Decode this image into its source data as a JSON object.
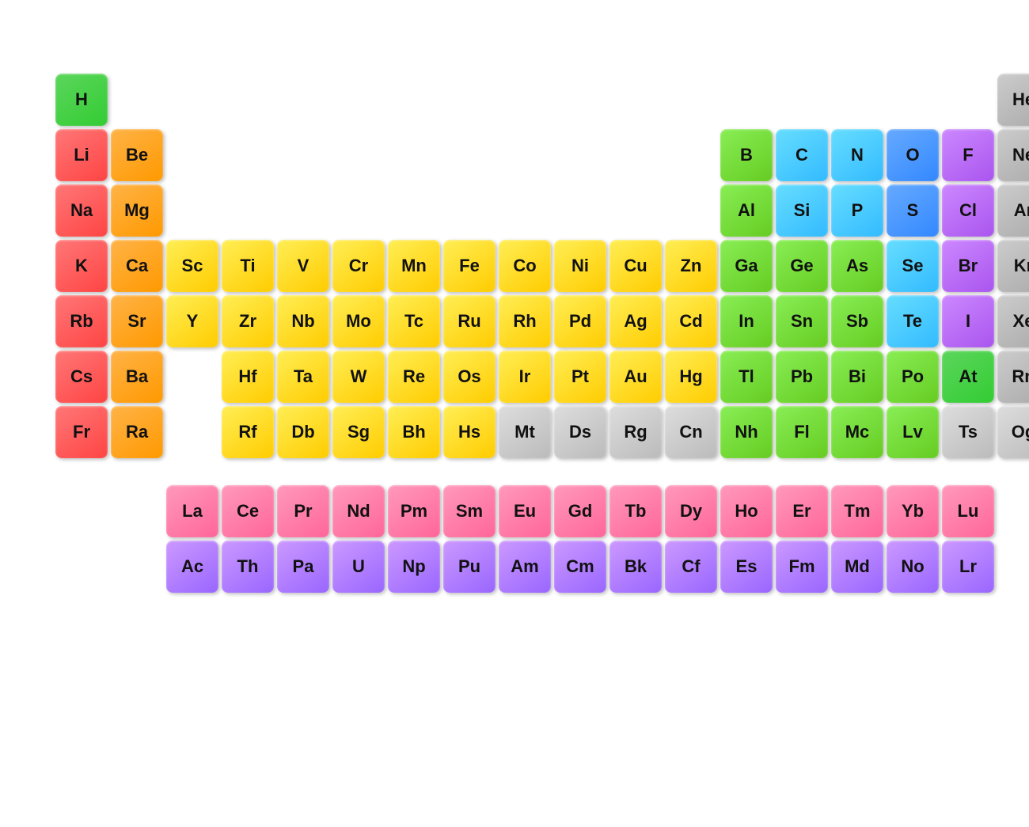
{
  "elements": [
    {
      "symbol": "H",
      "col": 0,
      "row": 0,
      "color": "c-green"
    },
    {
      "symbol": "He",
      "col": 17,
      "row": 0,
      "color": "c-gray"
    },
    {
      "symbol": "Li",
      "col": 0,
      "row": 1,
      "color": "c-red"
    },
    {
      "symbol": "Be",
      "col": 1,
      "row": 1,
      "color": "c-orange"
    },
    {
      "symbol": "B",
      "col": 12,
      "row": 1,
      "color": "c-lgreen"
    },
    {
      "symbol": "C",
      "col": 13,
      "row": 1,
      "color": "c-cyan"
    },
    {
      "symbol": "N",
      "col": 14,
      "row": 1,
      "color": "c-cyan"
    },
    {
      "symbol": "O",
      "col": 15,
      "row": 1,
      "color": "c-blue"
    },
    {
      "symbol": "F",
      "col": 16,
      "row": 1,
      "color": "c-purple"
    },
    {
      "symbol": "Ne",
      "col": 17,
      "row": 1,
      "color": "c-gray"
    },
    {
      "symbol": "Na",
      "col": 0,
      "row": 2,
      "color": "c-red"
    },
    {
      "symbol": "Mg",
      "col": 1,
      "row": 2,
      "color": "c-orange"
    },
    {
      "symbol": "Al",
      "col": 12,
      "row": 2,
      "color": "c-lgreen"
    },
    {
      "symbol": "Si",
      "col": 13,
      "row": 2,
      "color": "c-cyan"
    },
    {
      "symbol": "P",
      "col": 14,
      "row": 2,
      "color": "c-cyan"
    },
    {
      "symbol": "S",
      "col": 15,
      "row": 2,
      "color": "c-blue"
    },
    {
      "symbol": "Cl",
      "col": 16,
      "row": 2,
      "color": "c-purple"
    },
    {
      "symbol": "Ar",
      "col": 17,
      "row": 2,
      "color": "c-gray"
    },
    {
      "symbol": "K",
      "col": 0,
      "row": 3,
      "color": "c-red"
    },
    {
      "symbol": "Ca",
      "col": 1,
      "row": 3,
      "color": "c-orange"
    },
    {
      "symbol": "Sc",
      "col": 2,
      "row": 3,
      "color": "c-yellow"
    },
    {
      "symbol": "Ti",
      "col": 3,
      "row": 3,
      "color": "c-yellow"
    },
    {
      "symbol": "V",
      "col": 4,
      "row": 3,
      "color": "c-yellow"
    },
    {
      "symbol": "Cr",
      "col": 5,
      "row": 3,
      "color": "c-yellow"
    },
    {
      "symbol": "Mn",
      "col": 6,
      "row": 3,
      "color": "c-yellow"
    },
    {
      "symbol": "Fe",
      "col": 7,
      "row": 3,
      "color": "c-yellow"
    },
    {
      "symbol": "Co",
      "col": 8,
      "row": 3,
      "color": "c-yellow"
    },
    {
      "symbol": "Ni",
      "col": 9,
      "row": 3,
      "color": "c-yellow"
    },
    {
      "symbol": "Cu",
      "col": 10,
      "row": 3,
      "color": "c-yellow"
    },
    {
      "symbol": "Zn",
      "col": 11,
      "row": 3,
      "color": "c-yellow"
    },
    {
      "symbol": "Ga",
      "col": 12,
      "row": 3,
      "color": "c-lgreen"
    },
    {
      "symbol": "Ge",
      "col": 13,
      "row": 3,
      "color": "c-lgreen"
    },
    {
      "symbol": "As",
      "col": 14,
      "row": 3,
      "color": "c-lgreen"
    },
    {
      "symbol": "Se",
      "col": 15,
      "row": 3,
      "color": "c-cyan"
    },
    {
      "symbol": "Br",
      "col": 16,
      "row": 3,
      "color": "c-purple"
    },
    {
      "symbol": "Kr",
      "col": 17,
      "row": 3,
      "color": "c-gray"
    },
    {
      "symbol": "Rb",
      "col": 0,
      "row": 4,
      "color": "c-red"
    },
    {
      "symbol": "Sr",
      "col": 1,
      "row": 4,
      "color": "c-orange"
    },
    {
      "symbol": "Y",
      "col": 2,
      "row": 4,
      "color": "c-yellow"
    },
    {
      "symbol": "Zr",
      "col": 3,
      "row": 4,
      "color": "c-yellow"
    },
    {
      "symbol": "Nb",
      "col": 4,
      "row": 4,
      "color": "c-yellow"
    },
    {
      "symbol": "Mo",
      "col": 5,
      "row": 4,
      "color": "c-yellow"
    },
    {
      "symbol": "Tc",
      "col": 6,
      "row": 4,
      "color": "c-yellow"
    },
    {
      "symbol": "Ru",
      "col": 7,
      "row": 4,
      "color": "c-yellow"
    },
    {
      "symbol": "Rh",
      "col": 8,
      "row": 4,
      "color": "c-yellow"
    },
    {
      "symbol": "Pd",
      "col": 9,
      "row": 4,
      "color": "c-yellow"
    },
    {
      "symbol": "Ag",
      "col": 10,
      "row": 4,
      "color": "c-yellow"
    },
    {
      "symbol": "Cd",
      "col": 11,
      "row": 4,
      "color": "c-yellow"
    },
    {
      "symbol": "In",
      "col": 12,
      "row": 4,
      "color": "c-lgreen"
    },
    {
      "symbol": "Sn",
      "col": 13,
      "row": 4,
      "color": "c-lgreen"
    },
    {
      "symbol": "Sb",
      "col": 14,
      "row": 4,
      "color": "c-lgreen"
    },
    {
      "symbol": "Te",
      "col": 15,
      "row": 4,
      "color": "c-cyan"
    },
    {
      "symbol": "I",
      "col": 16,
      "row": 4,
      "color": "c-purple"
    },
    {
      "symbol": "Xe",
      "col": 17,
      "row": 4,
      "color": "c-gray"
    },
    {
      "symbol": "Cs",
      "col": 0,
      "row": 5,
      "color": "c-red"
    },
    {
      "symbol": "Ba",
      "col": 1,
      "row": 5,
      "color": "c-orange"
    },
    {
      "symbol": "Hf",
      "col": 3,
      "row": 5,
      "color": "c-yellow"
    },
    {
      "symbol": "Ta",
      "col": 4,
      "row": 5,
      "color": "c-yellow"
    },
    {
      "symbol": "W",
      "col": 5,
      "row": 5,
      "color": "c-yellow"
    },
    {
      "symbol": "Re",
      "col": 6,
      "row": 5,
      "color": "c-yellow"
    },
    {
      "symbol": "Os",
      "col": 7,
      "row": 5,
      "color": "c-yellow"
    },
    {
      "symbol": "Ir",
      "col": 8,
      "row": 5,
      "color": "c-yellow"
    },
    {
      "symbol": "Pt",
      "col": 9,
      "row": 5,
      "color": "c-yellow"
    },
    {
      "symbol": "Au",
      "col": 10,
      "row": 5,
      "color": "c-yellow"
    },
    {
      "symbol": "Hg",
      "col": 11,
      "row": 5,
      "color": "c-yellow"
    },
    {
      "symbol": "Tl",
      "col": 12,
      "row": 5,
      "color": "c-lgreen"
    },
    {
      "symbol": "Pb",
      "col": 13,
      "row": 5,
      "color": "c-lgreen"
    },
    {
      "symbol": "Bi",
      "col": 14,
      "row": 5,
      "color": "c-lgreen"
    },
    {
      "symbol": "Po",
      "col": 15,
      "row": 5,
      "color": "c-lgreen"
    },
    {
      "symbol": "At",
      "col": 16,
      "row": 5,
      "color": "c-green"
    },
    {
      "symbol": "Rn",
      "col": 17,
      "row": 5,
      "color": "c-gray"
    },
    {
      "symbol": "Fr",
      "col": 0,
      "row": 6,
      "color": "c-red"
    },
    {
      "symbol": "Ra",
      "col": 1,
      "row": 6,
      "color": "c-orange"
    },
    {
      "symbol": "Rf",
      "col": 3,
      "row": 6,
      "color": "c-yellow"
    },
    {
      "symbol": "Db",
      "col": 4,
      "row": 6,
      "color": "c-yellow"
    },
    {
      "symbol": "Sg",
      "col": 5,
      "row": 6,
      "color": "c-yellow"
    },
    {
      "symbol": "Bh",
      "col": 6,
      "row": 6,
      "color": "c-yellow"
    },
    {
      "symbol": "Hs",
      "col": 7,
      "row": 6,
      "color": "c-yellow"
    },
    {
      "symbol": "Mt",
      "col": 8,
      "row": 6,
      "color": "c-silver"
    },
    {
      "symbol": "Ds",
      "col": 9,
      "row": 6,
      "color": "c-silver"
    },
    {
      "symbol": "Rg",
      "col": 10,
      "row": 6,
      "color": "c-silver"
    },
    {
      "symbol": "Cn",
      "col": 11,
      "row": 6,
      "color": "c-silver"
    },
    {
      "symbol": "Nh",
      "col": 12,
      "row": 6,
      "color": "c-lgreen"
    },
    {
      "symbol": "Fl",
      "col": 13,
      "row": 6,
      "color": "c-lgreen"
    },
    {
      "symbol": "Mc",
      "col": 14,
      "row": 6,
      "color": "c-lgreen"
    },
    {
      "symbol": "Lv",
      "col": 15,
      "row": 6,
      "color": "c-lgreen"
    },
    {
      "symbol": "Ts",
      "col": 16,
      "row": 6,
      "color": "c-silver"
    },
    {
      "symbol": "Og",
      "col": 17,
      "row": 6,
      "color": "c-silver"
    },
    {
      "symbol": "La",
      "col": 2,
      "row": 8,
      "color": "c-pink"
    },
    {
      "symbol": "Ce",
      "col": 3,
      "row": 8,
      "color": "c-pink"
    },
    {
      "symbol": "Pr",
      "col": 4,
      "row": 8,
      "color": "c-pink"
    },
    {
      "symbol": "Nd",
      "col": 5,
      "row": 8,
      "color": "c-pink"
    },
    {
      "symbol": "Pm",
      "col": 6,
      "row": 8,
      "color": "c-pink"
    },
    {
      "symbol": "Sm",
      "col": 7,
      "row": 8,
      "color": "c-pink"
    },
    {
      "symbol": "Eu",
      "col": 8,
      "row": 8,
      "color": "c-pink"
    },
    {
      "symbol": "Gd",
      "col": 9,
      "row": 8,
      "color": "c-pink"
    },
    {
      "symbol": "Tb",
      "col": 10,
      "row": 8,
      "color": "c-pink"
    },
    {
      "symbol": "Dy",
      "col": 11,
      "row": 8,
      "color": "c-pink"
    },
    {
      "symbol": "Ho",
      "col": 12,
      "row": 8,
      "color": "c-pink"
    },
    {
      "symbol": "Er",
      "col": 13,
      "row": 8,
      "color": "c-pink"
    },
    {
      "symbol": "Tm",
      "col": 14,
      "row": 8,
      "color": "c-pink"
    },
    {
      "symbol": "Yb",
      "col": 15,
      "row": 8,
      "color": "c-pink"
    },
    {
      "symbol": "Lu",
      "col": 16,
      "row": 8,
      "color": "c-pink"
    },
    {
      "symbol": "Ac",
      "col": 2,
      "row": 9,
      "color": "c-lavender"
    },
    {
      "symbol": "Th",
      "col": 3,
      "row": 9,
      "color": "c-lavender"
    },
    {
      "symbol": "Pa",
      "col": 4,
      "row": 9,
      "color": "c-lavender"
    },
    {
      "symbol": "U",
      "col": 5,
      "row": 9,
      "color": "c-lavender"
    },
    {
      "symbol": "Np",
      "col": 6,
      "row": 9,
      "color": "c-lavender"
    },
    {
      "symbol": "Pu",
      "col": 7,
      "row": 9,
      "color": "c-lavender"
    },
    {
      "symbol": "Am",
      "col": 8,
      "row": 9,
      "color": "c-lavender"
    },
    {
      "symbol": "Cm",
      "col": 9,
      "row": 9,
      "color": "c-lavender"
    },
    {
      "symbol": "Bk",
      "col": 10,
      "row": 9,
      "color": "c-lavender"
    },
    {
      "symbol": "Cf",
      "col": 11,
      "row": 9,
      "color": "c-lavender"
    },
    {
      "symbol": "Es",
      "col": 12,
      "row": 9,
      "color": "c-lavender"
    },
    {
      "symbol": "Fm",
      "col": 13,
      "row": 9,
      "color": "c-lavender"
    },
    {
      "symbol": "Md",
      "col": 14,
      "row": 9,
      "color": "c-lavender"
    },
    {
      "symbol": "No",
      "col": 15,
      "row": 9,
      "color": "c-lavender"
    },
    {
      "symbol": "Lr",
      "col": 16,
      "row": 9,
      "color": "c-lavender"
    }
  ],
  "cell_size": 66,
  "gap": 4
}
